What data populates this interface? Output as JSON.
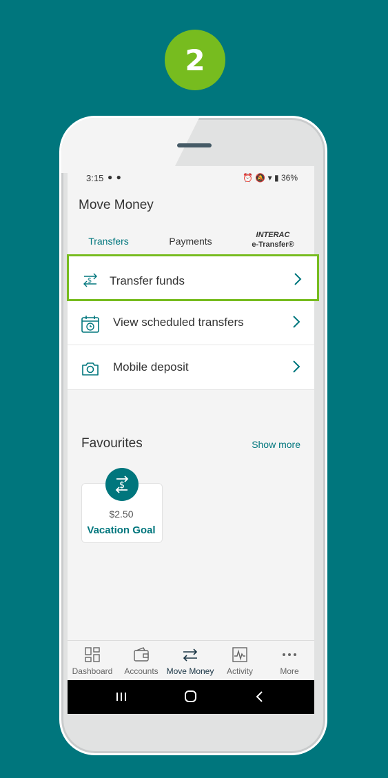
{
  "step": {
    "number": "2"
  },
  "status_bar": {
    "time": "3:15",
    "battery": "36%"
  },
  "header": {
    "title": "Move Money"
  },
  "tabs": [
    {
      "label": "Transfers"
    },
    {
      "label": "Payments"
    },
    {
      "label_line1": "INTERAC",
      "label_line2": "e-Transfer®"
    }
  ],
  "menu": {
    "items": [
      {
        "label": "Transfer funds",
        "icon": "transfer-dollar-icon"
      },
      {
        "label": "View scheduled transfers",
        "icon": "calendar-clock-icon"
      },
      {
        "label": "Mobile deposit",
        "icon": "camera-icon"
      }
    ]
  },
  "favourites": {
    "title": "Favourites",
    "show_more": "Show more",
    "card": {
      "amount": "$2.50",
      "name": "Vacation Goal"
    }
  },
  "bottom_nav": [
    {
      "label": "Dashboard"
    },
    {
      "label": "Accounts"
    },
    {
      "label": "Move Money"
    },
    {
      "label": "Activity"
    },
    {
      "label": "More"
    }
  ],
  "colors": {
    "teal": "#00767d",
    "green": "#77bc1f"
  }
}
